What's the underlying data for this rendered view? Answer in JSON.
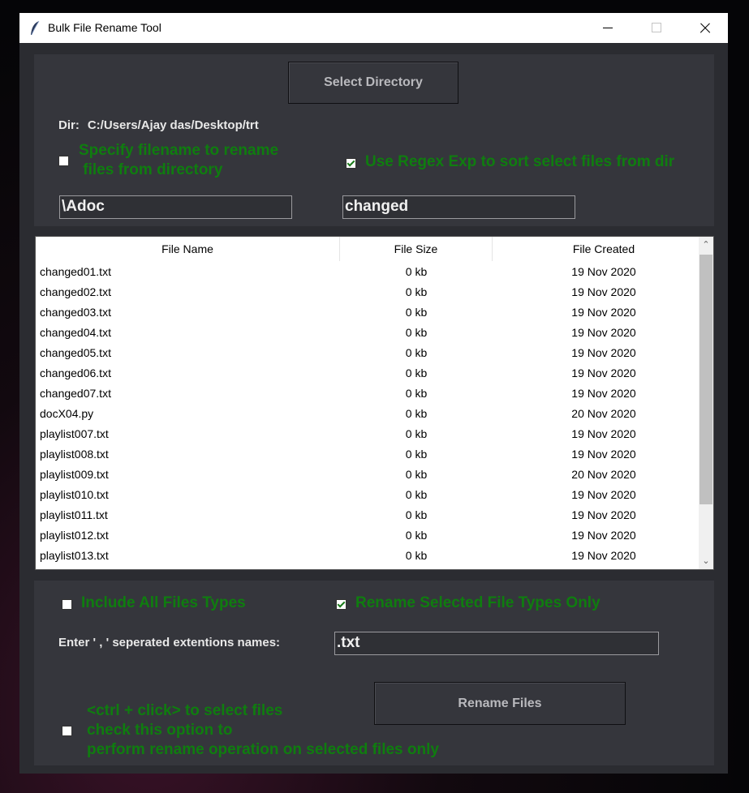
{
  "window": {
    "title": "Bulk File Rename Tool"
  },
  "select_directory_label": "Select Directory",
  "dir": {
    "prefix": "Dir:",
    "path": "C:/Users/Ajay das/Desktop/trt"
  },
  "options_top": {
    "specify_filename": {
      "line1": "Specify filename to rename",
      "line2": " files from directory",
      "checked": false
    },
    "use_regex": {
      "label": "Use Regex Exp to sort select files from dir",
      "checked": true
    }
  },
  "filename_input": "\\Adoc",
  "regex_input": "changed",
  "table": {
    "columns": [
      "File Name",
      "File Size",
      "File Created"
    ],
    "rows": [
      [
        "changed01.txt",
        "0 kb",
        "19 Nov 2020"
      ],
      [
        "changed02.txt",
        "0 kb",
        "19 Nov 2020"
      ],
      [
        "changed03.txt",
        "0 kb",
        "19 Nov 2020"
      ],
      [
        "changed04.txt",
        "0 kb",
        "19 Nov 2020"
      ],
      [
        "changed05.txt",
        "0 kb",
        "19 Nov 2020"
      ],
      [
        "changed06.txt",
        "0 kb",
        "19 Nov 2020"
      ],
      [
        "changed07.txt",
        "0 kb",
        "19 Nov 2020"
      ],
      [
        "docX04.py",
        "0 kb",
        "20 Nov 2020"
      ],
      [
        "playlist007.txt",
        "0 kb",
        "19 Nov 2020"
      ],
      [
        "playlist008.txt",
        "0 kb",
        "19 Nov 2020"
      ],
      [
        "playlist009.txt",
        "0 kb",
        "20 Nov 2020"
      ],
      [
        "playlist010.txt",
        "0 kb",
        "19 Nov 2020"
      ],
      [
        "playlist011.txt",
        "0 kb",
        "19 Nov 2020"
      ],
      [
        "playlist012.txt",
        "0 kb",
        "19 Nov 2020"
      ],
      [
        "playlist013.txt",
        "0 kb",
        "19 Nov 2020"
      ]
    ]
  },
  "options_bottom": {
    "include_all": {
      "label": "Include All Files Types",
      "checked": false
    },
    "rename_selected_types": {
      "label": "Rename Selected File Types Only",
      "checked": true
    }
  },
  "extensions_label": "Enter ' , ' seperated extentions names:",
  "extensions_input": ".txt",
  "selected_only": {
    "line1": "<ctrl + click> to select files",
    "line2": "check this option to",
    "line3": "perform rename operation on selected files only",
    "checked": false
  },
  "rename_files_label": "Rename Files",
  "colors": {
    "accent_green": "#0f7d0f",
    "panel": "#35363c",
    "window_bg": "#2b2c31"
  }
}
